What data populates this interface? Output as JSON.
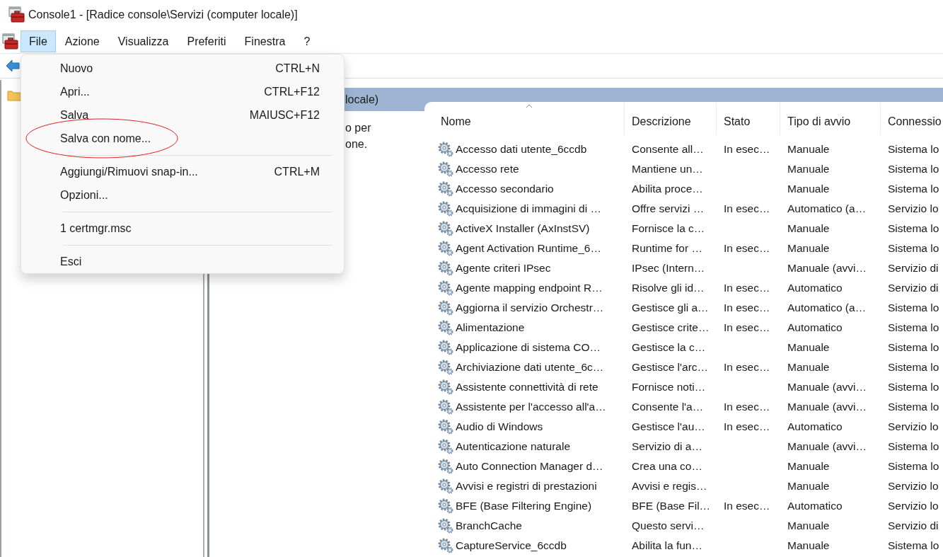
{
  "window": {
    "title": "Console1 - [Radice console\\Servizi (computer locale)]"
  },
  "menu_bar": [
    {
      "label": "File",
      "selected": true
    },
    {
      "label": "Azione",
      "selected": false
    },
    {
      "label": "Visualizza",
      "selected": false
    },
    {
      "label": "Preferiti",
      "selected": false
    },
    {
      "label": "Finestra",
      "selected": false
    },
    {
      "label": "?",
      "selected": false
    }
  ],
  "file_menu": {
    "items": [
      {
        "kind": "item",
        "label": "Nuovo",
        "shortcut": "CTRL+N",
        "circled": false
      },
      {
        "kind": "item",
        "label": "Apri...",
        "shortcut": "CTRL+F12",
        "circled": false
      },
      {
        "kind": "item",
        "label": "Salva",
        "shortcut": "MAIUSC+F12",
        "circled": false
      },
      {
        "kind": "item",
        "label": "Salva con nome...",
        "circled": true
      },
      {
        "kind": "separator"
      },
      {
        "kind": "item",
        "label": "Aggiungi/Rimuovi snap-in...",
        "shortcut": "CTRL+M",
        "circled": false
      },
      {
        "kind": "item",
        "label": "Opzioni...",
        "circled": false
      },
      {
        "kind": "separator"
      },
      {
        "kind": "item",
        "label": "1 certmgr.msc",
        "circled": false
      },
      {
        "kind": "separator"
      },
      {
        "kind": "item",
        "label": "Esci",
        "circled": false
      }
    ]
  },
  "details_pane": {
    "header": "locale)",
    "description": "o per\none."
  },
  "services_table": {
    "columns": [
      {
        "label": "Nome",
        "sorted": true
      },
      {
        "label": "Descrizione",
        "sorted": false
      },
      {
        "label": "Stato",
        "sorted": false
      },
      {
        "label": "Tipo di avvio",
        "sorted": false
      },
      {
        "label": "Connessio",
        "sorted": false
      }
    ],
    "rows": [
      {
        "name": "Accesso dati utente_6ccdb",
        "description": "Consente all…",
        "status": "In esec…",
        "startup": "Manuale",
        "logon": "Sistema lo"
      },
      {
        "name": "Accesso rete",
        "description": "Mantiene un…",
        "startup": "Manuale",
        "logon": "Sistema lo"
      },
      {
        "name": "Accesso secondario",
        "description": "Abilita proce…",
        "startup": "Manuale",
        "logon": "Sistema lo"
      },
      {
        "name": "Acquisizione di immagini di …",
        "description": "Offre servizi …",
        "status": "In esec…",
        "startup": "Automatico (a…",
        "logon": "Servizio lo"
      },
      {
        "name": "ActiveX Installer (AxInstSV)",
        "description": "Fornisce la c…",
        "startup": "Manuale",
        "logon": "Sistema lo"
      },
      {
        "name": "Agent Activation Runtime_6…",
        "description": "Runtime for …",
        "status": "In esec…",
        "startup": "Manuale",
        "logon": "Sistema lo"
      },
      {
        "name": "Agente criteri IPsec",
        "description": "IPsec (Intern…",
        "startup": "Manuale (avvi…",
        "logon": "Servizio di"
      },
      {
        "name": "Agente mapping endpoint R…",
        "description": "Risolve gli id…",
        "status": "In esec…",
        "startup": "Automatico",
        "logon": "Servizio di"
      },
      {
        "name": "Aggiorna il servizio Orchestr…",
        "description": "Gestisce gli a…",
        "status": "In esec…",
        "startup": "Automatico (a…",
        "logon": "Sistema lo"
      },
      {
        "name": "Alimentazione",
        "description": "Gestisce crite…",
        "status": "In esec…",
        "startup": "Automatico",
        "logon": "Sistema lo"
      },
      {
        "name": "Applicazione di sistema CO…",
        "description": "Gestisce la c…",
        "startup": "Manuale",
        "logon": "Sistema lo"
      },
      {
        "name": "Archiviazione dati utente_6c…",
        "description": "Gestisce l'arc…",
        "status": "In esec…",
        "startup": "Manuale",
        "logon": "Sistema lo"
      },
      {
        "name": "Assistente connettività di rete",
        "description": "Fornisce noti…",
        "startup": "Manuale (avvi…",
        "logon": "Sistema lo"
      },
      {
        "name": "Assistente per l'accesso all'a…",
        "description": "Consente l'a…",
        "status": "In esec…",
        "startup": "Manuale (avvi…",
        "logon": "Sistema lo"
      },
      {
        "name": "Audio di Windows",
        "description": "Gestisce l'au…",
        "status": "In esec…",
        "startup": "Automatico",
        "logon": "Servizio lo"
      },
      {
        "name": "Autenticazione naturale",
        "description": "Servizio di a…",
        "startup": "Manuale (avvi…",
        "logon": "Sistema lo"
      },
      {
        "name": "Auto Connection Manager d…",
        "description": "Crea una co…",
        "startup": "Manuale",
        "logon": "Sistema lo"
      },
      {
        "name": "Avvisi e registri di prestazioni",
        "description": "Avvisi e regis…",
        "startup": "Manuale",
        "logon": "Servizio lo"
      },
      {
        "name": "BFE (Base Filtering Engine)",
        "description": "BFE (Base Fil…",
        "status": "In esec…",
        "startup": "Automatico",
        "logon": "Servizio lo"
      },
      {
        "name": "BranchCache",
        "description": "Questo servi…",
        "startup": "Manuale",
        "logon": "Servizio di"
      },
      {
        "name": "CaptureService_6ccdb",
        "description": "Abilita la fun…",
        "startup": "Manuale",
        "logon": "Sistema lo"
      }
    ]
  }
}
